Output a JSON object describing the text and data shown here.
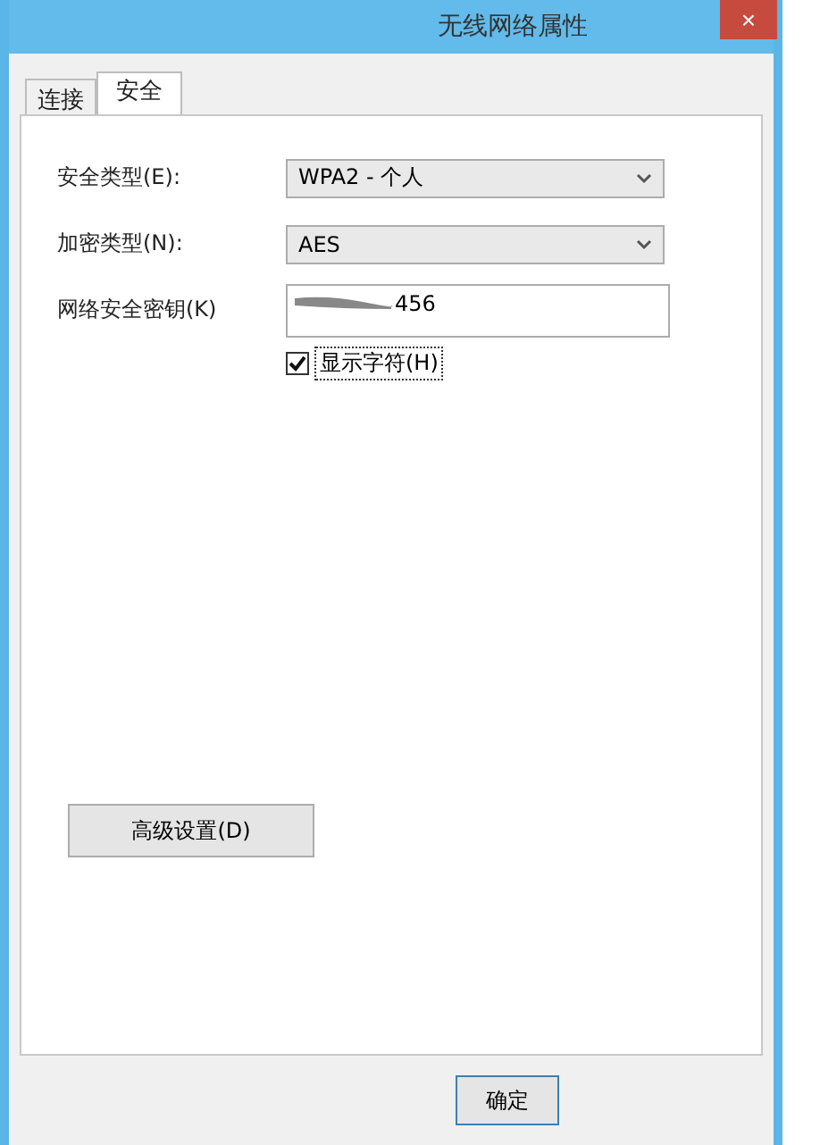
{
  "window": {
    "title": "无线网络属性",
    "close": "×"
  },
  "tabs": [
    {
      "label": "连接",
      "selected": false
    },
    {
      "label": "安全",
      "selected": true
    }
  ],
  "fields": [
    {
      "kind": "dropdown",
      "label": "安全类型(E):",
      "value": "WPA2 - 个人"
    },
    {
      "kind": "dropdown",
      "label": "加密类型(N):",
      "value": "AES"
    },
    {
      "kind": "text",
      "label": "网络安全密钥(K)",
      "value": "456",
      "redacted": true
    }
  ],
  "show_characters": {
    "label": "显示字符(H)",
    "checked": true
  },
  "advanced_button": "高级设置(D)",
  "buttons": [
    "确定"
  ]
}
